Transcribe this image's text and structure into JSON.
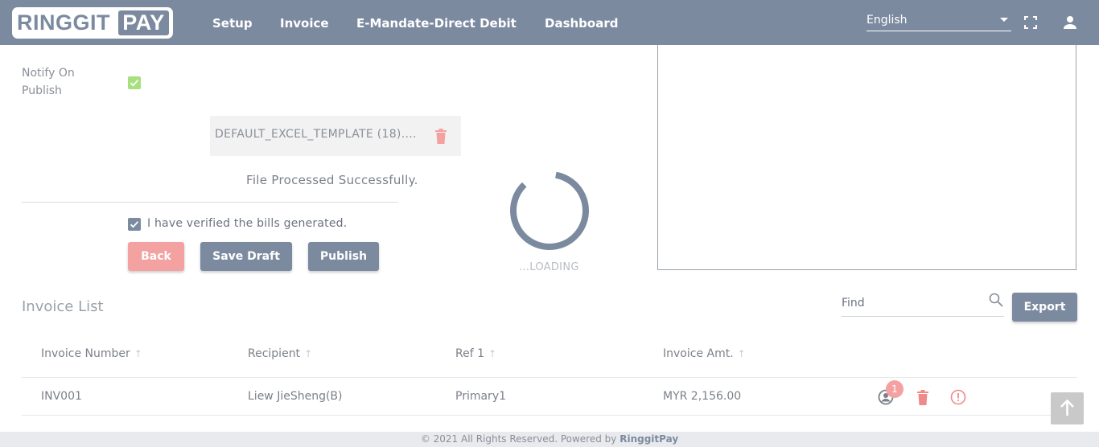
{
  "header": {
    "logo_left": "RINGGIT",
    "logo_right": "PAY",
    "nav": [
      {
        "label": "Setup"
      },
      {
        "label": "Invoice"
      },
      {
        "label": "E-Mandate-Direct Debit"
      },
      {
        "label": "Dashboard"
      }
    ],
    "language": "English"
  },
  "form": {
    "notify_label": "Notify On Publish",
    "file_name": "DEFAULT_EXCEL_TEMPLATE (18)....",
    "status_message": "File Processed Successfully.",
    "verify_label": "I have verified the bills generated.",
    "buttons": {
      "back": "Back",
      "save_draft": "Save Draft",
      "publish": "Publish"
    }
  },
  "loader": {
    "text": "...LOADING"
  },
  "invoice_list": {
    "title": "Invoice List",
    "find_placeholder": "Find",
    "export_label": "Export",
    "columns": [
      "Invoice Number",
      "Recipient",
      "Ref 1",
      "Invoice Amt."
    ],
    "rows": [
      {
        "invoice_number": "INV001",
        "recipient": "Liew JieSheng(B)",
        "ref1": "Primary1",
        "amount": "MYR 2,156.00",
        "badge": "1"
      }
    ]
  },
  "footer": {
    "text": "© 2021 All Rights Reserved. Powered by",
    "brand": "RinggitPay"
  },
  "colors": {
    "header": "#7c8aa0",
    "back_button": "#f4a1a1",
    "primary_button": "#7c8aa0",
    "trash": "#f08a8a",
    "verified_green": "#a8e07f"
  },
  "icons": [
    "fullscreen-icon",
    "user-icon",
    "trash-icon",
    "search-icon",
    "user-circle-icon",
    "alert-icon",
    "arrow-up-icon"
  ]
}
